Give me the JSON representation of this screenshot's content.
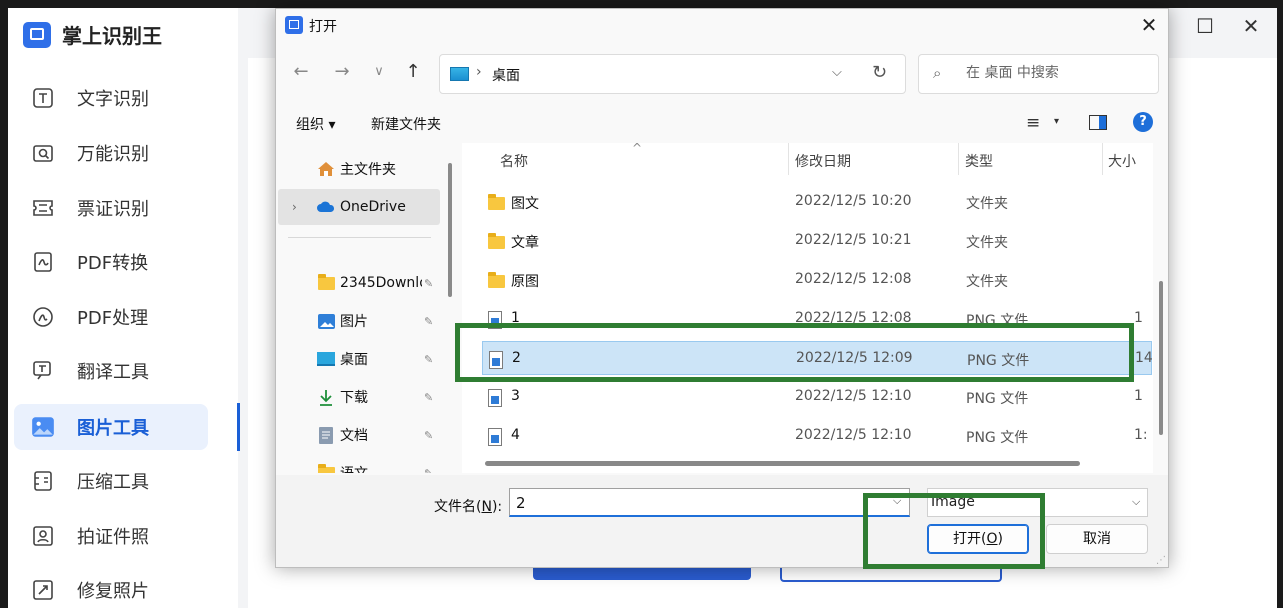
{
  "app": {
    "title": "掌上识别王",
    "nav": [
      {
        "label": "文字识别",
        "icon": "text-recognition-icon"
      },
      {
        "label": "万能识别",
        "icon": "universal-recognition-icon"
      },
      {
        "label": "票证识别",
        "icon": "ticket-recognition-icon"
      },
      {
        "label": "PDF转换",
        "icon": "pdf-convert-icon"
      },
      {
        "label": "PDF处理",
        "icon": "pdf-process-icon"
      },
      {
        "label": "翻译工具",
        "icon": "translate-icon"
      },
      {
        "label": "图片工具",
        "icon": "image-tools-icon",
        "active": true
      },
      {
        "label": "压缩工具",
        "icon": "compress-icon"
      },
      {
        "label": "拍证件照",
        "icon": "id-photo-icon"
      },
      {
        "label": "修复照片",
        "icon": "photo-repair-icon"
      }
    ],
    "window_controls": {
      "maximize": "☐",
      "close": "✕"
    },
    "accent": "#1a5fd6"
  },
  "dialog": {
    "title": "打开",
    "close": "✕",
    "nav": {
      "back": "←",
      "forward": "→",
      "recent": "∨",
      "up": "↑"
    },
    "address": {
      "separator": "›",
      "location": "桌面",
      "dropdown": "⌵",
      "refresh": "↻"
    },
    "search": {
      "placeholder": "在 桌面 中搜索",
      "icon": "⌕"
    },
    "toolbar": {
      "organize": "组织 ▾",
      "new_folder": "新建文件夹",
      "view": "≡",
      "view_drop": "▾",
      "help": "?"
    },
    "nav_pane": [
      {
        "label": "主文件夹",
        "icon": "home-icon",
        "pinned": false
      },
      {
        "label": "OneDrive",
        "icon": "onedrive-icon",
        "expandable": true,
        "selected": true
      },
      {
        "label": "2345Downlo",
        "icon": "folder-icon",
        "pinned": true
      },
      {
        "label": "图片",
        "icon": "pictures-icon",
        "pinned": true
      },
      {
        "label": "桌面",
        "icon": "desktop-icon",
        "pinned": true
      },
      {
        "label": "下载",
        "icon": "download-icon",
        "pinned": true
      },
      {
        "label": "文档",
        "icon": "documents-icon",
        "pinned": true
      },
      {
        "label": "语文",
        "icon": "folder-icon",
        "pinned": true
      }
    ],
    "pin_glyph": "📌",
    "columns": {
      "name": "名称",
      "date": "修改日期",
      "type": "类型",
      "size": "大小"
    },
    "files": [
      {
        "name": "图文",
        "date": "2022/12/5 10:20",
        "type": "文件夹",
        "size": "",
        "kind": "folder"
      },
      {
        "name": "文章",
        "date": "2022/12/5 10:21",
        "type": "文件夹",
        "size": "",
        "kind": "folder"
      },
      {
        "name": "原图",
        "date": "2022/12/5 12:08",
        "type": "文件夹",
        "size": "",
        "kind": "folder"
      },
      {
        "name": "1",
        "date": "2022/12/5 12:08",
        "type": "PNG 文件",
        "size": "1",
        "kind": "png"
      },
      {
        "name": "2",
        "date": "2022/12/5 12:09",
        "type": "PNG 文件",
        "size": "14",
        "kind": "png",
        "selected": true
      },
      {
        "name": "3",
        "date": "2022/12/5 12:10",
        "type": "PNG 文件",
        "size": "1",
        "kind": "png"
      },
      {
        "name": "4",
        "date": "2022/12/5 12:10",
        "type": "PNG 文件",
        "size": "1:",
        "kind": "png"
      }
    ],
    "filename_label_pre": "文件名(",
    "filename_label_key": "N",
    "filename_label_post": "):",
    "filename_value": "2",
    "filetype_value": "Image",
    "open_pre": "打开(",
    "open_key": "O",
    "open_post": ")",
    "cancel": "取消",
    "highlight_color": "#2f7d32"
  }
}
